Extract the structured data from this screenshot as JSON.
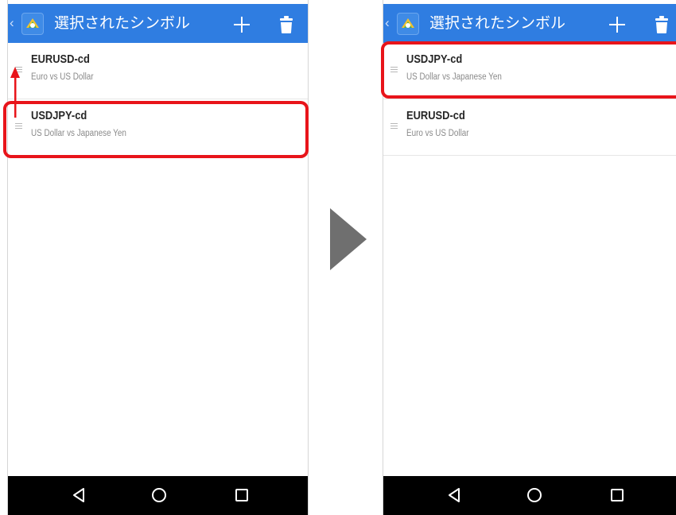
{
  "screens": [
    {
      "header": {
        "title": "選択されたシンボル"
      },
      "symbols": [
        {
          "symbol": "EURUSD-cd",
          "description": "Euro vs US Dollar"
        },
        {
          "symbol": "USDJPY-cd",
          "description": "US Dollar vs Japanese Yen"
        }
      ]
    },
    {
      "header": {
        "title": "選択されたシンボル"
      },
      "symbols": [
        {
          "symbol": "USDJPY-cd",
          "description": "US Dollar vs Japanese Yen"
        },
        {
          "symbol": "EURUSD-cd",
          "description": "Euro vs US Dollar"
        }
      ]
    }
  ],
  "icons": {
    "back": "chevron-left-icon",
    "logo": "metatrader-logo",
    "add": "plus-icon",
    "delete": "trash-icon",
    "drag": "drag-handle-icon",
    "nav_back": "triangle-back-icon",
    "nav_home": "circle-home-icon",
    "nav_recent": "square-recent-icon"
  },
  "colors": {
    "appbar": "#2f7de1",
    "highlight": "#e8141a",
    "navbar": "#000000",
    "transition_arrow": "#6f6f6f"
  }
}
